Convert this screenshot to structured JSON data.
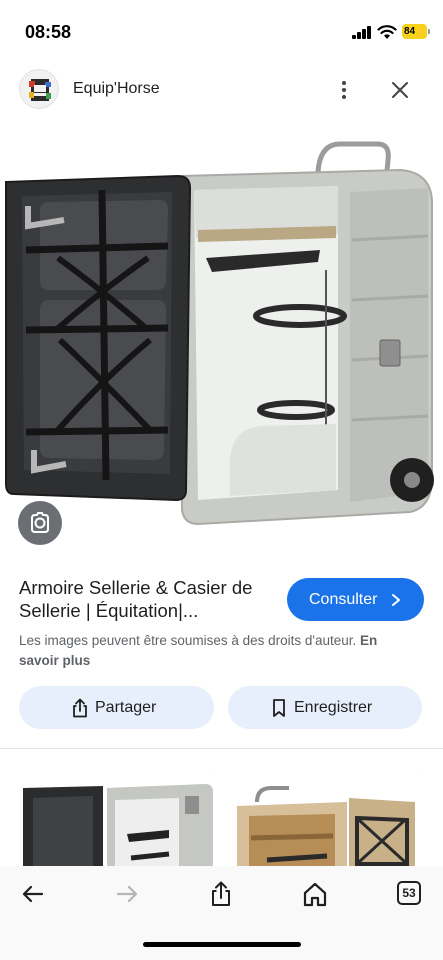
{
  "status_bar": {
    "time": "08:58",
    "battery": "84",
    "icons": [
      "signal-icon",
      "wifi-icon",
      "battery-icon"
    ]
  },
  "header": {
    "site_name": "Equip'Horse",
    "icons": [
      "site-logo",
      "more-vert-icon",
      "close-icon"
    ]
  },
  "result": {
    "title": "Armoire Sellerie & Casier de Sellerie | Équitation|...",
    "consult_label": "Consulter",
    "rights_text": "Les images peuvent être soumises à des droits d'auteur.",
    "rights_link": "En savoir plus"
  },
  "actions": {
    "share_label": "Partager",
    "save_label": "Enregistrer"
  },
  "toolbar": {
    "tab_count": "53",
    "icons": [
      "back-arrow-icon",
      "forward-arrow-icon",
      "share-icon",
      "home-icon",
      "tabs-icon"
    ]
  },
  "colors": {
    "accent": "#1a73e8",
    "pill_bg": "#e8effc",
    "battery": "#f7d21c"
  }
}
